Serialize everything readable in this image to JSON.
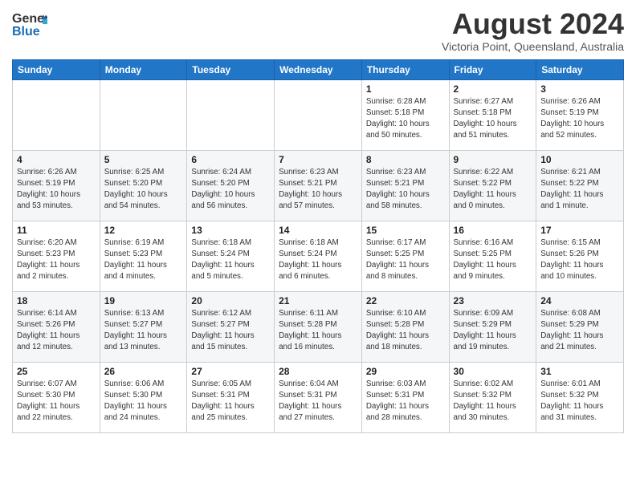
{
  "header": {
    "logo_line1": "General",
    "logo_line2": "Blue",
    "month_year": "August 2024",
    "location": "Victoria Point, Queensland, Australia"
  },
  "days_of_week": [
    "Sunday",
    "Monday",
    "Tuesday",
    "Wednesday",
    "Thursday",
    "Friday",
    "Saturday"
  ],
  "weeks": [
    [
      {
        "num": "",
        "detail": ""
      },
      {
        "num": "",
        "detail": ""
      },
      {
        "num": "",
        "detail": ""
      },
      {
        "num": "",
        "detail": ""
      },
      {
        "num": "1",
        "detail": "Sunrise: 6:28 AM\nSunset: 5:18 PM\nDaylight: 10 hours\nand 50 minutes."
      },
      {
        "num": "2",
        "detail": "Sunrise: 6:27 AM\nSunset: 5:18 PM\nDaylight: 10 hours\nand 51 minutes."
      },
      {
        "num": "3",
        "detail": "Sunrise: 6:26 AM\nSunset: 5:19 PM\nDaylight: 10 hours\nand 52 minutes."
      }
    ],
    [
      {
        "num": "4",
        "detail": "Sunrise: 6:26 AM\nSunset: 5:19 PM\nDaylight: 10 hours\nand 53 minutes."
      },
      {
        "num": "5",
        "detail": "Sunrise: 6:25 AM\nSunset: 5:20 PM\nDaylight: 10 hours\nand 54 minutes."
      },
      {
        "num": "6",
        "detail": "Sunrise: 6:24 AM\nSunset: 5:20 PM\nDaylight: 10 hours\nand 56 minutes."
      },
      {
        "num": "7",
        "detail": "Sunrise: 6:23 AM\nSunset: 5:21 PM\nDaylight: 10 hours\nand 57 minutes."
      },
      {
        "num": "8",
        "detail": "Sunrise: 6:23 AM\nSunset: 5:21 PM\nDaylight: 10 hours\nand 58 minutes."
      },
      {
        "num": "9",
        "detail": "Sunrise: 6:22 AM\nSunset: 5:22 PM\nDaylight: 11 hours\nand 0 minutes."
      },
      {
        "num": "10",
        "detail": "Sunrise: 6:21 AM\nSunset: 5:22 PM\nDaylight: 11 hours\nand 1 minute."
      }
    ],
    [
      {
        "num": "11",
        "detail": "Sunrise: 6:20 AM\nSunset: 5:23 PM\nDaylight: 11 hours\nand 2 minutes."
      },
      {
        "num": "12",
        "detail": "Sunrise: 6:19 AM\nSunset: 5:23 PM\nDaylight: 11 hours\nand 4 minutes."
      },
      {
        "num": "13",
        "detail": "Sunrise: 6:18 AM\nSunset: 5:24 PM\nDaylight: 11 hours\nand 5 minutes."
      },
      {
        "num": "14",
        "detail": "Sunrise: 6:18 AM\nSunset: 5:24 PM\nDaylight: 11 hours\nand 6 minutes."
      },
      {
        "num": "15",
        "detail": "Sunrise: 6:17 AM\nSunset: 5:25 PM\nDaylight: 11 hours\nand 8 minutes."
      },
      {
        "num": "16",
        "detail": "Sunrise: 6:16 AM\nSunset: 5:25 PM\nDaylight: 11 hours\nand 9 minutes."
      },
      {
        "num": "17",
        "detail": "Sunrise: 6:15 AM\nSunset: 5:26 PM\nDaylight: 11 hours\nand 10 minutes."
      }
    ],
    [
      {
        "num": "18",
        "detail": "Sunrise: 6:14 AM\nSunset: 5:26 PM\nDaylight: 11 hours\nand 12 minutes."
      },
      {
        "num": "19",
        "detail": "Sunrise: 6:13 AM\nSunset: 5:27 PM\nDaylight: 11 hours\nand 13 minutes."
      },
      {
        "num": "20",
        "detail": "Sunrise: 6:12 AM\nSunset: 5:27 PM\nDaylight: 11 hours\nand 15 minutes."
      },
      {
        "num": "21",
        "detail": "Sunrise: 6:11 AM\nSunset: 5:28 PM\nDaylight: 11 hours\nand 16 minutes."
      },
      {
        "num": "22",
        "detail": "Sunrise: 6:10 AM\nSunset: 5:28 PM\nDaylight: 11 hours\nand 18 minutes."
      },
      {
        "num": "23",
        "detail": "Sunrise: 6:09 AM\nSunset: 5:29 PM\nDaylight: 11 hours\nand 19 minutes."
      },
      {
        "num": "24",
        "detail": "Sunrise: 6:08 AM\nSunset: 5:29 PM\nDaylight: 11 hours\nand 21 minutes."
      }
    ],
    [
      {
        "num": "25",
        "detail": "Sunrise: 6:07 AM\nSunset: 5:30 PM\nDaylight: 11 hours\nand 22 minutes."
      },
      {
        "num": "26",
        "detail": "Sunrise: 6:06 AM\nSunset: 5:30 PM\nDaylight: 11 hours\nand 24 minutes."
      },
      {
        "num": "27",
        "detail": "Sunrise: 6:05 AM\nSunset: 5:31 PM\nDaylight: 11 hours\nand 25 minutes."
      },
      {
        "num": "28",
        "detail": "Sunrise: 6:04 AM\nSunset: 5:31 PM\nDaylight: 11 hours\nand 27 minutes."
      },
      {
        "num": "29",
        "detail": "Sunrise: 6:03 AM\nSunset: 5:31 PM\nDaylight: 11 hours\nand 28 minutes."
      },
      {
        "num": "30",
        "detail": "Sunrise: 6:02 AM\nSunset: 5:32 PM\nDaylight: 11 hours\nand 30 minutes."
      },
      {
        "num": "31",
        "detail": "Sunrise: 6:01 AM\nSunset: 5:32 PM\nDaylight: 11 hours\nand 31 minutes."
      }
    ]
  ]
}
